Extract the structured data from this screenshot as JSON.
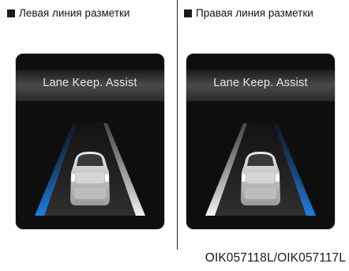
{
  "columns": [
    {
      "label": "Левая линия разметки",
      "title": "Lane Keep. Assist",
      "highlighted_lane": "left"
    },
    {
      "label": "Правая линия разметки",
      "title": "Lane Keep. Assist",
      "highlighted_lane": "right"
    }
  ],
  "code": "OIK057118L/OIK057117L",
  "colors": {
    "panel_background": "#0e0e0e",
    "lane_highlight": "#1e7fe0",
    "lane_normal": "#eeeeee"
  },
  "icons": [
    "car-icon",
    "square-bullet-icon"
  ]
}
